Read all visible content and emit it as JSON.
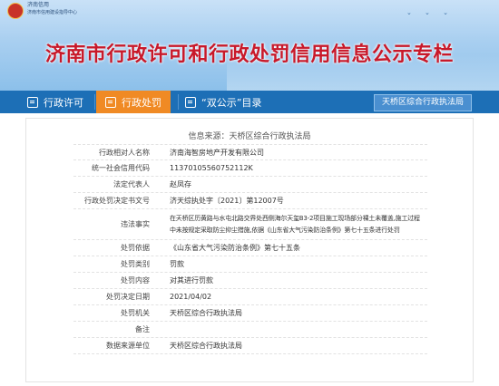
{
  "header": {
    "logo_text_line1": "济南信用",
    "logo_text_line2": "济南市信用建设指导中心",
    "title": "济南市行政许可和行政处罚信用信息公示专栏"
  },
  "nav": {
    "tabs": [
      {
        "label": "行政许可",
        "icon": "document-icon",
        "active": false
      },
      {
        "label": "行政处罚",
        "icon": "document-icon",
        "active": true
      },
      {
        "label": "“双公示”目录",
        "icon": "calendar-icon",
        "active": false
      }
    ],
    "agency_button": "天桥区综合行政执法局"
  },
  "colors": {
    "nav_bg": "#1d6fb6",
    "active_tab": "#f08a24",
    "title": "#c8192a"
  },
  "record": {
    "source": "信息来源：天桥区综合行政执法局",
    "fields": [
      {
        "label": "行政相对人名称",
        "value": "济南海智房地产开发有限公司"
      },
      {
        "label": "统一社会信用代码",
        "value": "11370105560752112K"
      },
      {
        "label": "法定代表人",
        "value": "赵凤存"
      },
      {
        "label": "行政处罚决定书文号",
        "value": "济天综执处字〔2021〕第12007号"
      },
      {
        "label": "违法事实",
        "value": "在天桥区历黄路与水屯北路交界处西侧海尔天玺B3-2项目施工现场部分裸土未覆盖,施工过程",
        "value2": "中未按规定采取防尘抑尘措施,依据《山东省大气污染防治条例》第七十五条进行处罚"
      },
      {
        "label": "处罚依据",
        "value": "《山东省大气污染防治条例》第七十五条"
      },
      {
        "label": "处罚类别",
        "value": "罚款"
      },
      {
        "label": "处罚内容",
        "value": "对其进行罚款"
      },
      {
        "label": "处罚决定日期",
        "value": "2021/04/02"
      },
      {
        "label": "处罚机关",
        "value": "天桥区综合行政执法局"
      },
      {
        "label": "备注",
        "value": ""
      },
      {
        "label": "数据来源单位",
        "value": "天桥区综合行政执法局"
      }
    ]
  }
}
